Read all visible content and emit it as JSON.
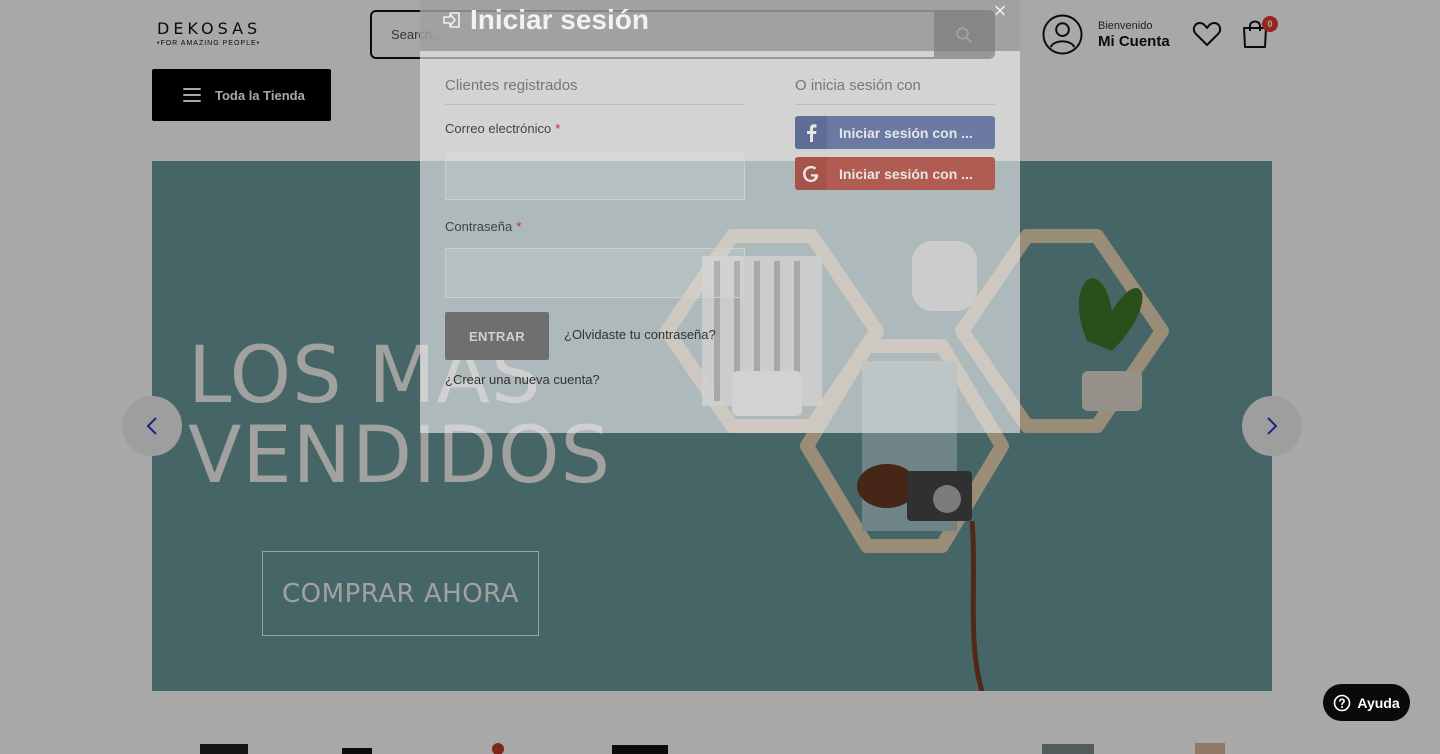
{
  "header": {
    "brand": "DEKOSAS",
    "tagline": "•FOR AMAZING PEOPLE•",
    "search_placeholder": "Search...",
    "account_greeting": "Bienvenido",
    "account_label": "Mi Cuenta",
    "cart_count": "0",
    "all_store_label": "Toda la Tienda"
  },
  "banner": {
    "line1": "LOS MÁS",
    "line2": "VENDIDOS",
    "cta": "COMPRAR AHORA"
  },
  "modal": {
    "title": "Iniciar sesión",
    "close": "×",
    "registered_heading": "Clientes registrados",
    "social_heading": "O inicia sesión con",
    "email_label": "Correo electrónico",
    "password_label": "Contraseña",
    "required_mark": "*",
    "submit_label": "ENTRAR",
    "forgot_label": "¿Olvidaste tu contraseña?",
    "create_label": "¿Crear una nueva cuenta?",
    "facebook_label": "Iniciar sesión con ...",
    "google_label": "Iniciar sesión con ..."
  },
  "help": {
    "label": "Ayuda"
  },
  "colors": {
    "banner_bg": "#6b9a9b",
    "facebook": "#6a7aa3",
    "google": "#b15c52",
    "cart_badge": "#e53935",
    "arrow": "#2a35d6"
  },
  "icons": [
    "search-icon",
    "user-circle-icon",
    "heart-icon",
    "shopping-bag-icon",
    "menu-icon",
    "login-icon",
    "close-icon",
    "facebook-icon",
    "google-icon",
    "chevron-left-icon",
    "chevron-right-icon",
    "help-icon"
  ]
}
